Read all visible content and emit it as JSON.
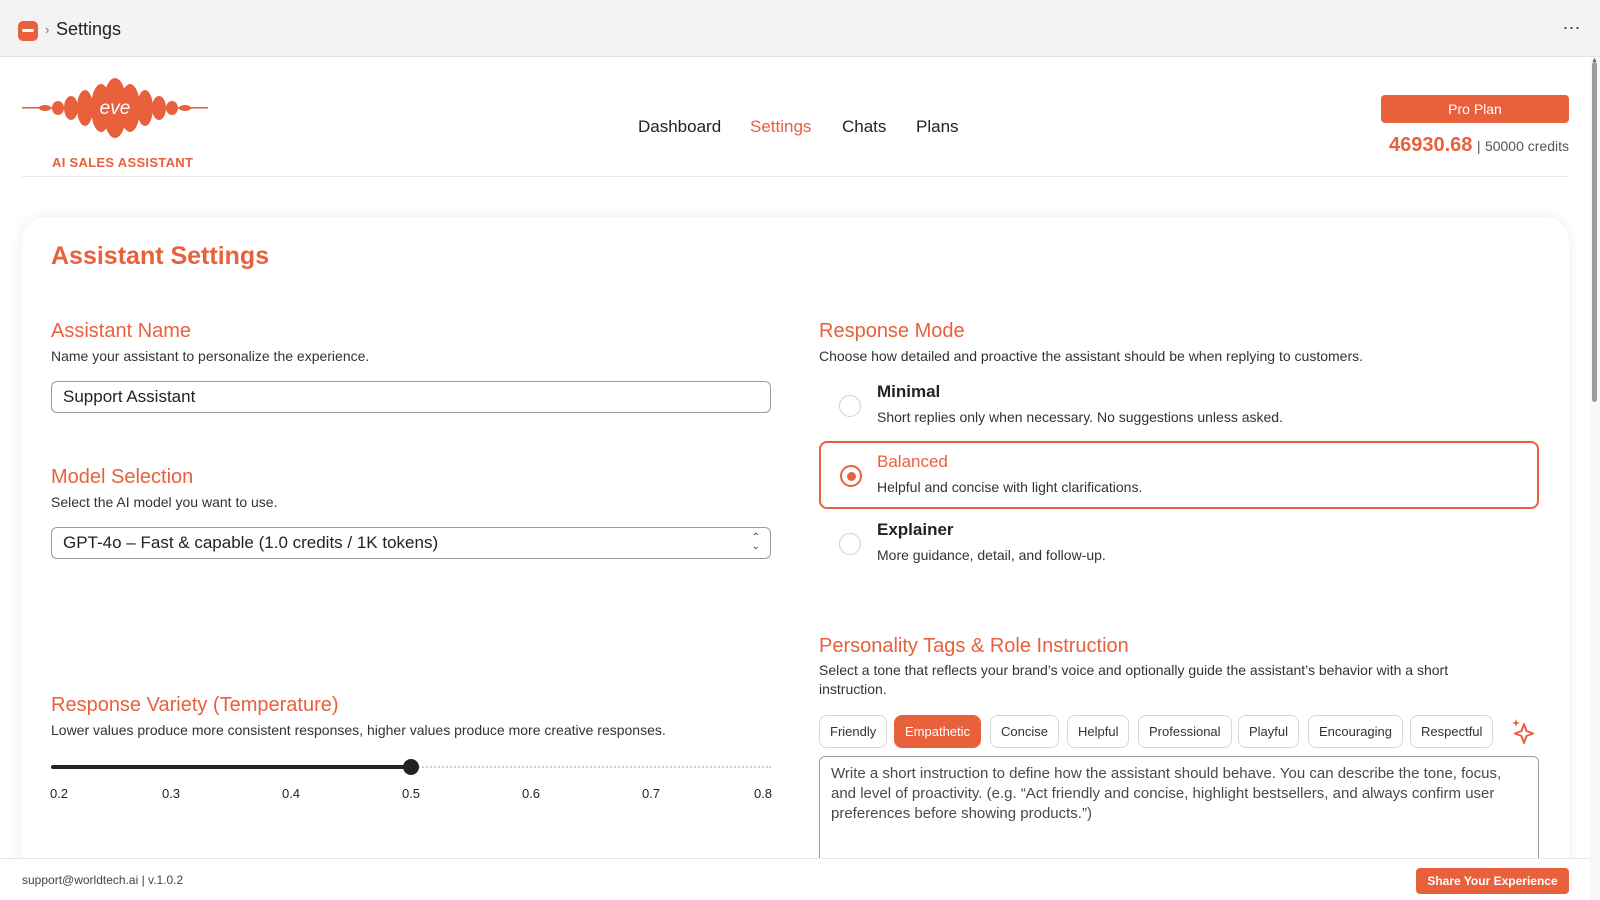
{
  "titlebar": {
    "icon": "app-icon",
    "separator": "›",
    "title": "Settings",
    "more_icon": "…"
  },
  "header": {
    "logo_alt": "eve",
    "logo_subtitle": "AI SALES ASSISTANT",
    "nav": [
      {
        "label": "Dashboard",
        "active": false
      },
      {
        "label": "Settings",
        "active": true
      },
      {
        "label": "Chats",
        "active": false
      },
      {
        "label": "Plans",
        "active": false
      }
    ],
    "plan_button": "Pro Plan",
    "credits_used": "46930.68",
    "credits_separator": "|",
    "credits_total": "50000 credits"
  },
  "page": {
    "title": "Assistant Settings"
  },
  "assistant_name": {
    "title": "Assistant Name",
    "description": "Name your assistant to personalize the experience.",
    "value": "Support Assistant"
  },
  "model": {
    "title": "Model Selection",
    "description": "Select the AI model you want to use.",
    "selected": "GPT-4o – Fast & capable (1.0 credits / 1K tokens)"
  },
  "temperature": {
    "title": "Response Variety (Temperature)",
    "description": "Lower values produce more consistent responses, higher values produce more creative responses.",
    "min": 0.2,
    "max": 0.8,
    "value": 0.5,
    "ticks": [
      "0.2",
      "0.3",
      "0.4",
      "0.5",
      "0.6",
      "0.7",
      "0.8"
    ]
  },
  "response_mode": {
    "title": "Response Mode",
    "description": "Choose how detailed and proactive the assistant should be when replying to customers.",
    "options": [
      {
        "title": "Minimal",
        "description": "Short replies only when necessary. No suggestions unless asked.",
        "selected": false
      },
      {
        "title": "Balanced",
        "description": "Helpful and concise with light clarifications.",
        "selected": true
      },
      {
        "title": "Explainer",
        "description": "More guidance, detail, and follow-up.",
        "selected": false
      }
    ]
  },
  "personality": {
    "title": "Personality Tags & Role Instruction",
    "description": "Select a tone that reflects your brand’s voice and optionally guide the assistant’s behavior with a short instruction.",
    "tags": [
      {
        "label": "Friendly",
        "active": false
      },
      {
        "label": "Empathetic",
        "active": true
      },
      {
        "label": "Concise",
        "active": false
      },
      {
        "label": "Helpful",
        "active": false
      },
      {
        "label": "Professional",
        "active": false
      },
      {
        "label": "Playful",
        "active": false
      },
      {
        "label": "Encouraging",
        "active": false
      },
      {
        "label": "Respectful",
        "active": false
      }
    ],
    "sparkle_icon": "sparkle-icon",
    "instruction_placeholder": "Write a short instruction to define how the assistant should behave. You can describe the tone, focus, and level of proactivity. (e.g. “Act friendly and concise, highlight bestsellers, and always confirm user preferences before showing products.”)"
  },
  "footer": {
    "contact": "support@worldtech.ai | v.1.0.2",
    "share_button": "Share Your Experience"
  },
  "colors": {
    "accent": "#e8603c",
    "text": "#222222",
    "border": "#9b9b9b"
  }
}
